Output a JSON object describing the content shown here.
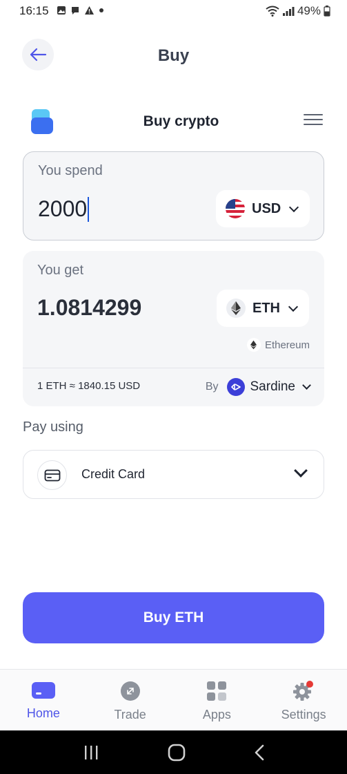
{
  "status_bar": {
    "time": "16:15",
    "battery": "49%",
    "icons": [
      "image-icon",
      "message-icon",
      "alert-icon",
      "dot-icon",
      "wifi-icon",
      "signal-icon",
      "battery-icon"
    ]
  },
  "header": {
    "title": "Buy"
  },
  "widget": {
    "title": "Buy crypto"
  },
  "spend": {
    "label": "You spend",
    "amount": "2000",
    "currency": "USD"
  },
  "get": {
    "label": "You get",
    "amount": "1.0814299",
    "currency": "ETH",
    "network": "Ethereum",
    "rate": "1 ETH ≈ 1840.15 USD",
    "provider_prefix": "By",
    "provider": "Sardine"
  },
  "payment": {
    "label": "Pay using",
    "method": "Credit Card"
  },
  "action": {
    "buy_label": "Buy ETH"
  },
  "bottom_nav": {
    "items": [
      {
        "label": "Home",
        "active": true
      },
      {
        "label": "Trade",
        "active": false
      },
      {
        "label": "Apps",
        "active": false
      },
      {
        "label": "Settings",
        "active": false
      }
    ]
  },
  "colors": {
    "accent": "#5a5ff5",
    "nav_active": "#4f55e8",
    "notification": "#e53935"
  }
}
